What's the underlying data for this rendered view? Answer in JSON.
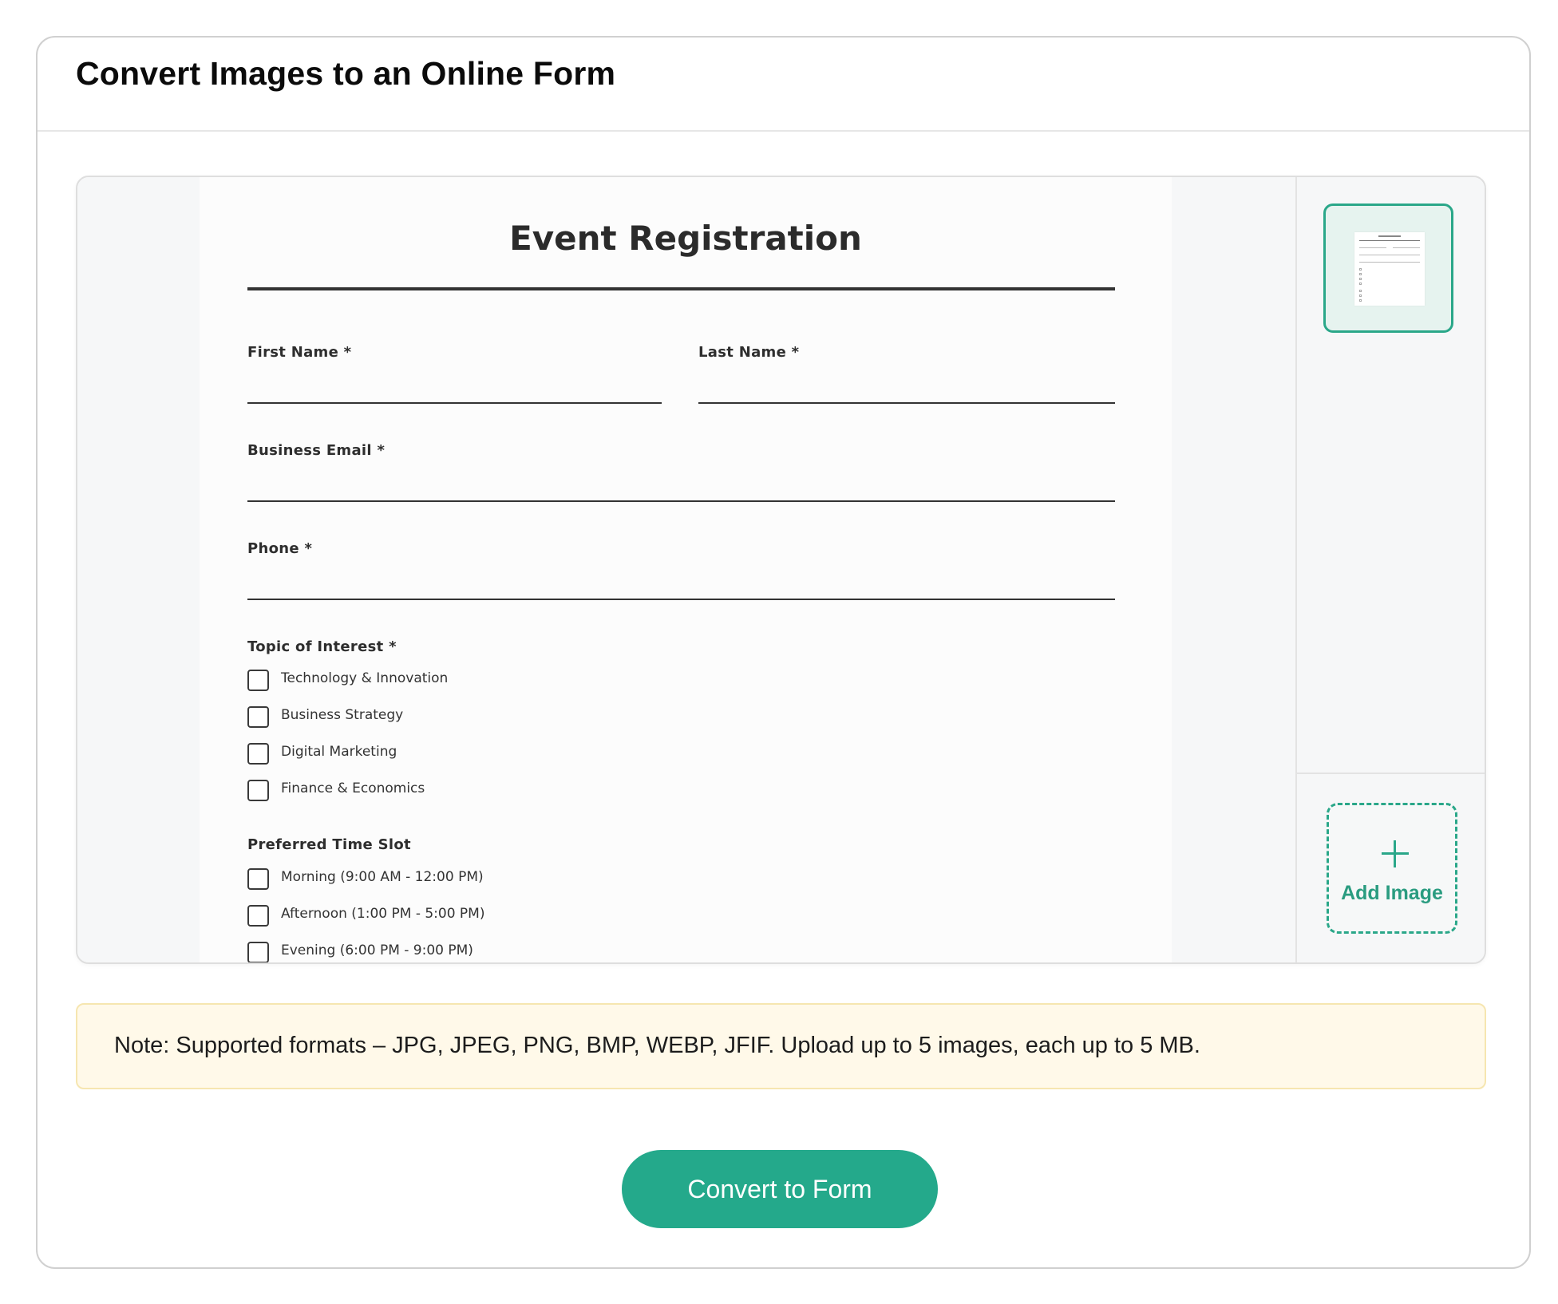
{
  "header": {
    "title": "Convert Images to an Online Form"
  },
  "preview": {
    "form_title": "Event Registration",
    "fields": {
      "first_name": "First Name *",
      "last_name": "Last Name *",
      "business_email": "Business Email *",
      "phone": "Phone *"
    },
    "topic": {
      "label": "Topic of Interest *",
      "options": [
        "Technology & Innovation",
        "Business Strategy",
        "Digital Marketing",
        "Finance & Economics"
      ]
    },
    "time_slot": {
      "label": "Preferred Time Slot",
      "options": [
        "Morning (9:00 AM - 12:00 PM)",
        "Afternoon (1:00 PM - 5:00 PM)",
        "Evening (6:00 PM - 9:00 PM)"
      ]
    }
  },
  "sidebar": {
    "add_image_label": "Add Image",
    "add_icon": "plus-icon"
  },
  "note": {
    "text": "Note: Supported formats – JPG, JPEG, PNG, BMP, WEBP, JFIF. Upload up to 5 images, each up to 5 MB."
  },
  "actions": {
    "convert_label": "Convert to Form"
  },
  "colors": {
    "accent": "#24a98b",
    "note_bg": "#fff9e9",
    "note_border": "#f6e6b0"
  }
}
